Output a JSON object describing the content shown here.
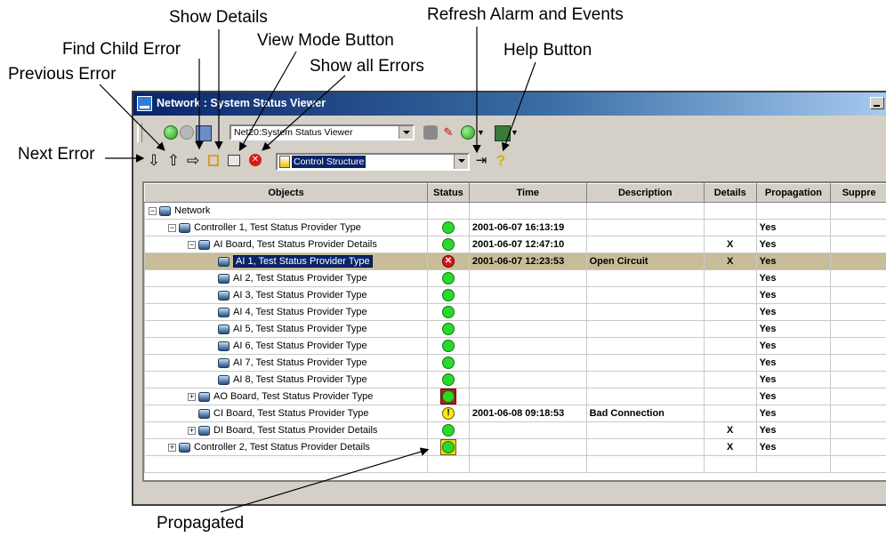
{
  "callouts": {
    "show_details": "Show Details",
    "refresh": "Refresh Alarm and Events",
    "find_child": "Find Child Error",
    "view_mode": "View Mode Button",
    "previous_error": "Previous Error",
    "show_all": "Show all Errors",
    "help": "Help Button",
    "next_error": "Next Error",
    "propagated": "Propagated"
  },
  "window": {
    "title": "Network : System Status Viewer",
    "address_combo": "Net20:System Status Viewer",
    "view_combo": "Control Structure"
  },
  "grid": {
    "columns": [
      "Objects",
      "Status",
      "Time",
      "Description",
      "Details",
      "Propagation",
      "Suppre"
    ],
    "rows": [
      {
        "object": "Network",
        "level": 0,
        "expander": "-",
        "status": "",
        "time": "",
        "description": "",
        "details": "",
        "propagation": ""
      },
      {
        "object": "Controller 1, Test Status Provider Type",
        "level": 1,
        "expander": "-",
        "status": "ok",
        "time": "2001-06-07 16:13:19",
        "description": "",
        "details": "",
        "propagation": "Yes"
      },
      {
        "object": "AI Board, Test Status Provider Details",
        "level": 2,
        "expander": "-",
        "status": "ok",
        "time": "2001-06-07 12:47:10",
        "description": "",
        "details": "X",
        "propagation": "Yes"
      },
      {
        "object": "AI 1, Test Status Provider Type",
        "level": 3,
        "expander": "",
        "status": "error",
        "time": "2001-06-07 12:23:53",
        "description": "Open Circuit",
        "details": "X",
        "propagation": "Yes",
        "highlight": true
      },
      {
        "object": "AI 2, Test Status Provider Type",
        "level": 3,
        "expander": "",
        "status": "ok",
        "time": "",
        "description": "",
        "details": "",
        "propagation": "Yes"
      },
      {
        "object": "AI 3, Test Status Provider Type",
        "level": 3,
        "expander": "",
        "status": "ok",
        "time": "",
        "description": "",
        "details": "",
        "propagation": "Yes"
      },
      {
        "object": "AI 4, Test Status Provider Type",
        "level": 3,
        "expander": "",
        "status": "ok",
        "time": "",
        "description": "",
        "details": "",
        "propagation": "Yes"
      },
      {
        "object": "AI 5, Test Status Provider Type",
        "level": 3,
        "expander": "",
        "status": "ok",
        "time": "",
        "description": "",
        "details": "",
        "propagation": "Yes"
      },
      {
        "object": "AI 6, Test Status Provider Type",
        "level": 3,
        "expander": "",
        "status": "ok",
        "time": "",
        "description": "",
        "details": "",
        "propagation": "Yes"
      },
      {
        "object": "AI 7, Test Status Provider Type",
        "level": 3,
        "expander": "",
        "status": "ok",
        "time": "",
        "description": "",
        "details": "",
        "propagation": "Yes"
      },
      {
        "object": "AI 8, Test Status Provider Type",
        "level": 3,
        "expander": "",
        "status": "ok",
        "time": "",
        "description": "",
        "details": "",
        "propagation": "Yes"
      },
      {
        "object": "AO Board, Test Status Provider Type",
        "level": 2,
        "expander": "+",
        "status": "propagated-red",
        "time": "",
        "description": "",
        "details": "",
        "propagation": "Yes"
      },
      {
        "object": "CI Board, Test Status Provider Type",
        "level": 2,
        "expander": "",
        "status": "warning",
        "time": "2001-06-08 09:18:53",
        "description": "Bad Connection",
        "details": "",
        "propagation": "Yes"
      },
      {
        "object": "DI Board, Test Status Provider Details",
        "level": 2,
        "expander": "+",
        "status": "ok",
        "time": "",
        "description": "",
        "details": "X",
        "propagation": "Yes"
      },
      {
        "object": "Controller 2, Test Status Provider Details",
        "level": 1,
        "expander": "+",
        "status": "propagated-yellow",
        "time": "",
        "description": "",
        "details": "X",
        "propagation": "Yes"
      }
    ]
  },
  "icons": [
    "back-icon",
    "forward-icon",
    "opc-icon",
    "next-error-icon",
    "previous-error-icon",
    "find-child-error-icon",
    "show-details-icon",
    "view-mode-icon",
    "show-all-errors-icon",
    "control-structure-icon",
    "refresh-icon",
    "help-icon"
  ],
  "colors": {
    "title_bar": "#0a246a",
    "selection": "#0a246a",
    "highlight_row": "#c8bd98",
    "status_ok": "#2dd82d",
    "status_error": "#d81818",
    "status_warning": "#ffe81a"
  }
}
